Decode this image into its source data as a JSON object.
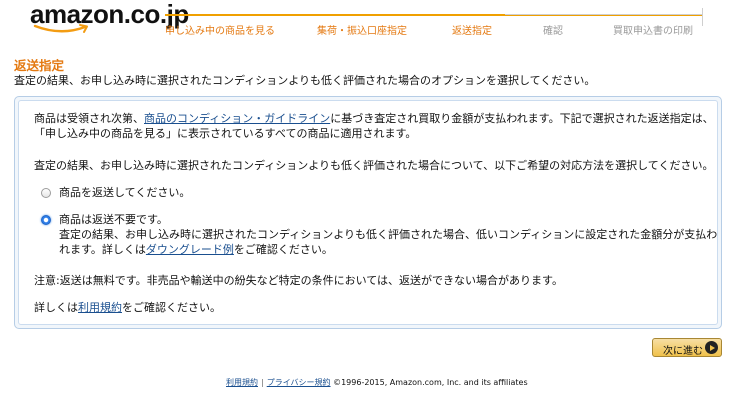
{
  "logo": {
    "text": "amazon.co.jp"
  },
  "steps": [
    {
      "label": "申し込み中の商品を見る",
      "state": "done"
    },
    {
      "label": "集荷・振込口座指定",
      "state": "done"
    },
    {
      "label": "返送指定",
      "state": "current"
    },
    {
      "label": "確認",
      "state": "pending"
    },
    {
      "label": "買取申込書の印刷",
      "state": "pending"
    }
  ],
  "page": {
    "title": "返送指定",
    "subtitle": "査定の結果、お申し込み時に選択されたコンディションよりも低く評価された場合のオプションを選択してください。"
  },
  "panel": {
    "intro_before_link": "商品は受領され次第、",
    "intro_link": "商品のコンディション・ガイドライン",
    "intro_after_link": "に基づき査定され買取り金額が支払われます。下記で選択された返送指定は、",
    "intro_line2": "「申し込み中の商品を見る」に表示されているすべての商品に適用されます。",
    "question": "査定の結果、お申し込み時に選択されたコンディションよりも低く評価された場合について、以下ご希望の対応方法を選択してください。",
    "options": [
      {
        "label": "商品を返送してください。",
        "selected": false
      },
      {
        "label": "商品は返送不要です。",
        "selected": true,
        "desc_line1": "査定の結果、お申し込み時に選択されたコンディションよりも低く評価された場合、低いコンディションに設定された金額分が支払わ",
        "desc_line2_before": "れます。詳しくは",
        "desc_link": "ダウングレード例",
        "desc_line2_after": "をご確認ください。"
      }
    ],
    "note": "注意:返送は無料です。非売品や輸送中の紛失など特定の条件においては、返送ができない場合があります。",
    "terms_before": "詳しくは",
    "terms_link": "利用規約",
    "terms_after": "をご確認ください。"
  },
  "next_button": {
    "label": "次に進む"
  },
  "footer": {
    "terms": "利用規約",
    "privacy": "プライバシー規約",
    "copyright": "©1996-2015, Amazon.com, Inc. and its affiliates"
  },
  "colors": {
    "accent": "#e47911",
    "link": "#1a4f8f",
    "radio_selected": "#2f7ee8"
  }
}
